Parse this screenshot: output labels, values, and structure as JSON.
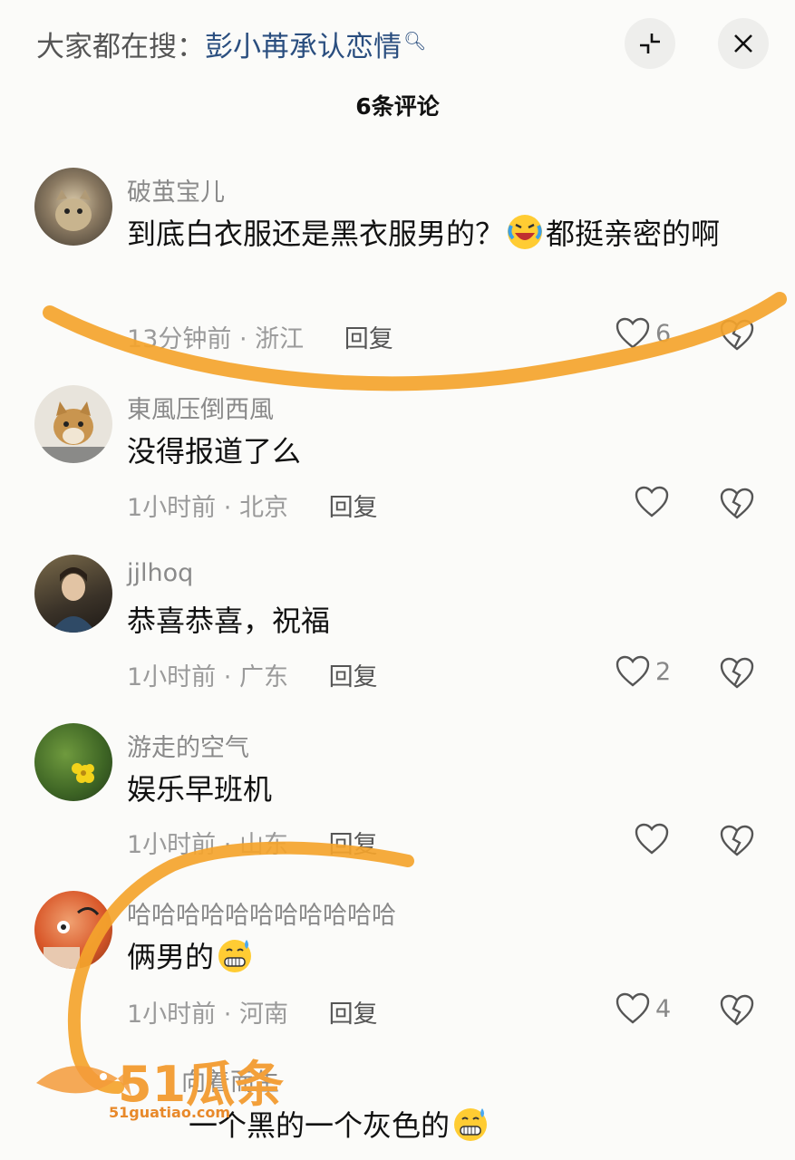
{
  "header": {
    "search_prefix": "大家都在搜：",
    "search_term": "彭小苒承认恋情",
    "comment_count": "6条评论"
  },
  "comments": [
    {
      "username": "破茧宝儿",
      "text_a": "到底白衣服还是黑衣服男的？",
      "text_b": "都挺亲密的啊",
      "time": "13分钟前",
      "location": "浙江",
      "reply": "回复",
      "likes": "6"
    },
    {
      "username": "東風压倒西風",
      "text": "没得报道了么",
      "time": "1小时前",
      "location": "北京",
      "reply": "回复",
      "likes": ""
    },
    {
      "username": "jjlhoq",
      "text": "恭喜恭喜，祝福",
      "time": "1小时前",
      "location": "广东",
      "reply": "回复",
      "likes": "2"
    },
    {
      "username": "游走的空气",
      "text": "娱乐早班机",
      "time": "1小时前",
      "location": "山东",
      "reply": "回复",
      "likes": ""
    },
    {
      "username": "哈哈哈哈哈哈哈哈哈哈哈",
      "text": "俩男的",
      "time": "1小时前",
      "location": "河南",
      "reply": "回复",
      "likes": "4"
    },
    {
      "username": "向着而生",
      "text": "一个黑的一个灰色的",
      "time": "",
      "location": "",
      "reply": "",
      "likes": ""
    }
  ],
  "separator": "·",
  "watermark": {
    "brand": "51瓜条",
    "domain": "51guatiao.com"
  },
  "icons": {
    "collapse": "collapse-icon",
    "close": "close-icon",
    "like": "heart-icon",
    "dislike": "broken-heart-icon"
  },
  "colors": {
    "search_term": "#2a4e7f",
    "annotation_stroke": "#f4a42d"
  }
}
